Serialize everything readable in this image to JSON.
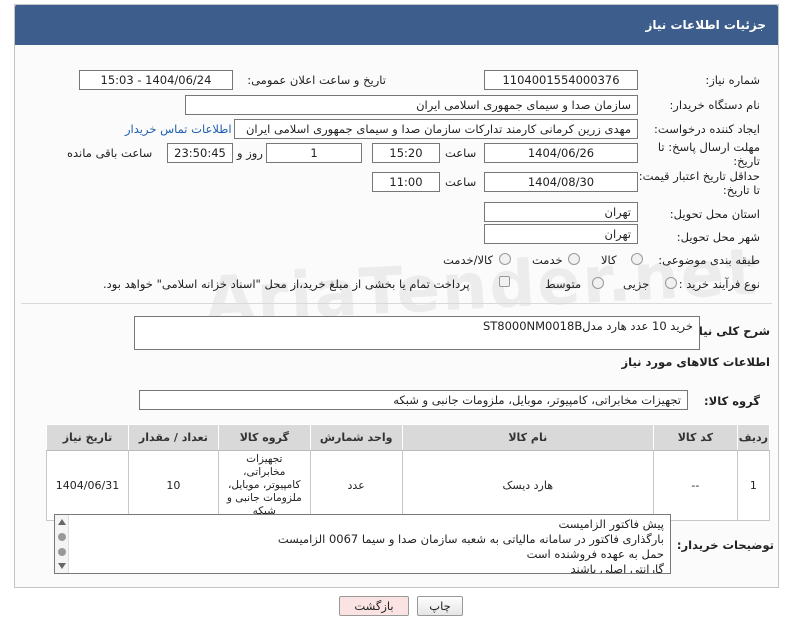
{
  "header": {
    "title": "جزئیات اطلاعات نیاز"
  },
  "fields": {
    "need_number_label": "شماره نیاز:",
    "need_number": "1104001554000376",
    "announce_label": "تاریخ و ساعت اعلان عمومی:",
    "announce_value": "1404/06/24 - 15:03",
    "buyer_org_label": "نام دستگاه خریدار:",
    "buyer_org": "سازمان صدا و سیمای جمهوری اسلامی ایران",
    "requester_label": "ایجاد کننده درخواست:",
    "requester": "مهدی زرین کرمانی کارمند تدارکات سازمان صدا و سیمای جمهوری اسلامی ایران",
    "contact_link": "اطلاعات تماس خریدار",
    "reply_deadline_label": "مهلت ارسال پاسخ: تا تاریخ:",
    "reply_date": "1404/06/26",
    "time_label": "ساعت",
    "reply_time": "15:20",
    "days_value": "1",
    "days_label": "روز و",
    "remaining_time": "23:50:45",
    "remaining_label": "ساعت باقی مانده",
    "price_deadline_label": "حداقل تاریخ اعتبار قیمت: تا تاریخ:",
    "price_date": "1404/08/30",
    "price_time": "11:00",
    "province_label": "استان محل تحویل:",
    "province": "تهران",
    "city_label": "شهر محل تحویل:",
    "city": "تهران",
    "category_label": "طبقه بندی موضوعی:",
    "category_options": [
      "کالا",
      "خدمت",
      "کالا/خدمت"
    ],
    "process_label": "نوع فرآیند خرید :",
    "process_options": [
      "جزیی",
      "متوسط"
    ],
    "payment_note": "پرداخت تمام یا بخشی از مبلغ خرید،از محل \"اسناد خزانه اسلامی\" خواهد بود."
  },
  "description": {
    "label": "شرح کلی نیاز:",
    "value": "خرید 10 عدد هارد مدلST8000NM0018B"
  },
  "goods_section": {
    "title": "اطلاعات کالاهای مورد نیاز",
    "group_label": "گروه کالا:",
    "group_value": "تجهیزات مخابراتی، کامپیوتر، موبایل، ملزومات جانبی و شبکه"
  },
  "table": {
    "headers": [
      "ردیف",
      "کد کالا",
      "نام کالا",
      "واحد شمارش",
      "گروه کالا",
      "تعداد / مقدار",
      "تاریخ نیاز"
    ],
    "rows": [
      [
        "1",
        "--",
        "هارد دیسک",
        "عدد",
        "تجهیزات مخابراتی، کامپیوتر، موبایل، ملزومات جانبی و شبکه",
        "10",
        "1404/06/31"
      ]
    ]
  },
  "notes": {
    "label": "توضیحات خریدار:",
    "lines": [
      "پیش فاکتور الزامیست",
      "بارگذاری فاکتور در سامانه مالیاتی به شعبه سازمان صدا و سیما 0067 الزامیست",
      "حمل به عهده فروشنده است",
      "گارانتی اصلی باشند"
    ]
  },
  "buttons": {
    "print": "چاپ",
    "back": "بازگشت"
  },
  "watermark": "AriaTender.net",
  "colors": {
    "header_bg": "#3d5e8c",
    "link": "#1f5fb0",
    "back_button_bg": "#fbe3e3"
  }
}
